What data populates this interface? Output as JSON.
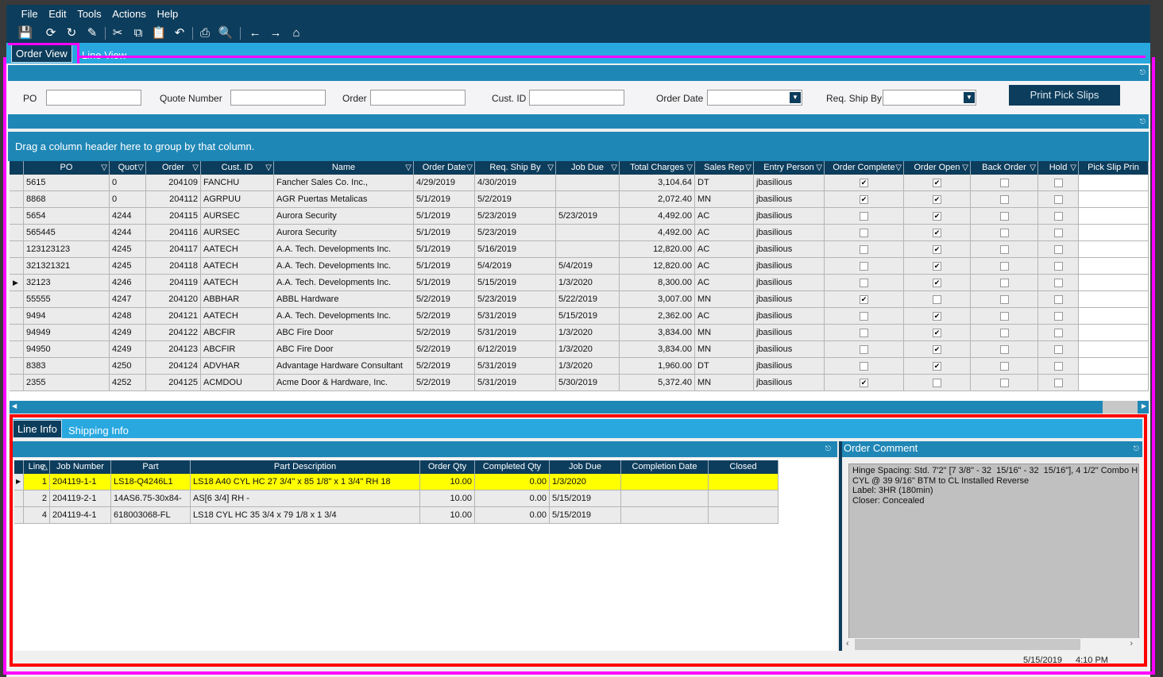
{
  "menu": [
    "File",
    "Edit",
    "Tools",
    "Actions",
    "Help"
  ],
  "toolbar_icons": [
    "save-icon",
    "refresh-icon",
    "sync-icon",
    "clear-icon",
    "cut-icon",
    "copy-icon",
    "paste-icon",
    "undo-icon",
    "print-icon",
    "print-preview-icon",
    "back-icon",
    "forward-icon",
    "home-icon"
  ],
  "tabs": {
    "order_view": "Order View",
    "line_view": "Line View"
  },
  "filters": {
    "po": {
      "label": "PO",
      "value": ""
    },
    "quote": {
      "label": "Quote Number",
      "value": ""
    },
    "order": {
      "label": "Order",
      "value": ""
    },
    "cust": {
      "label": "Cust. ID",
      "value": ""
    },
    "order_date": {
      "label": "Order Date",
      "value": ""
    },
    "req_ship": {
      "label": "Req. Ship By",
      "value": ""
    },
    "print_button": "Print Pick Slips"
  },
  "group_hint": "Drag a column header here to group by that column.",
  "orders": {
    "columns": [
      "PO",
      "Quot",
      "Order",
      "Cust. ID",
      "Name",
      "Order Date",
      "Req. Ship By",
      "Job Due",
      "Total Charges",
      "Sales Rep",
      "Entry Person",
      "Order Complete",
      "Order Open",
      "Back Order",
      "Hold",
      "Pick Slip Prin"
    ],
    "selected_row": 6,
    "rows": [
      [
        "5615",
        "0",
        "204109",
        "FANCHU",
        "Fancher Sales Co. Inc.,",
        "4/29/2019",
        "4/30/2019",
        "",
        "3,104.64",
        "DT",
        "jbasilious",
        true,
        true,
        false,
        false,
        ""
      ],
      [
        "8868",
        "0",
        "204112",
        "AGRPUU",
        "AGR Puertas Metalicas",
        "5/1/2019",
        "5/2/2019",
        "",
        "2,072.40",
        "MN",
        "jbasilious",
        true,
        true,
        false,
        false,
        ""
      ],
      [
        "5654",
        "4244",
        "204115",
        "AURSEC",
        "Aurora Security",
        "5/1/2019",
        "5/23/2019",
        "5/23/2019",
        "4,492.00",
        "AC",
        "jbasilious",
        false,
        true,
        false,
        false,
        ""
      ],
      [
        "565445",
        "4244",
        "204116",
        "AURSEC",
        "Aurora Security",
        "5/1/2019",
        "5/23/2019",
        "",
        "4,492.00",
        "AC",
        "jbasilious",
        false,
        true,
        false,
        false,
        ""
      ],
      [
        "123123123",
        "4245",
        "204117",
        "AATECH",
        "A.A. Tech. Developments Inc.",
        "5/1/2019",
        "5/16/2019",
        "",
        "12,820.00",
        "AC",
        "jbasilious",
        false,
        true,
        false,
        false,
        ""
      ],
      [
        "321321321",
        "4245",
        "204118",
        "AATECH",
        "A.A. Tech. Developments Inc.",
        "5/1/2019",
        "5/4/2019",
        "5/4/2019",
        "12,820.00",
        "AC",
        "jbasilious",
        false,
        true,
        false,
        false,
        ""
      ],
      [
        "32123",
        "4246",
        "204119",
        "AATECH",
        "A.A. Tech. Developments Inc.",
        "5/1/2019",
        "5/15/2019",
        "1/3/2020",
        "8,300.00",
        "AC",
        "jbasilious",
        false,
        true,
        false,
        false,
        ""
      ],
      [
        "55555",
        "4247",
        "204120",
        "ABBHAR",
        "ABBL Hardware",
        "5/2/2019",
        "5/23/2019",
        "5/22/2019",
        "3,007.00",
        "MN",
        "jbasilious",
        true,
        false,
        false,
        false,
        ""
      ],
      [
        "9494",
        "4248",
        "204121",
        "AATECH",
        "A.A. Tech. Developments Inc.",
        "5/2/2019",
        "5/31/2019",
        "5/15/2019",
        "2,362.00",
        "AC",
        "jbasilious",
        false,
        true,
        false,
        false,
        ""
      ],
      [
        "94949",
        "4249",
        "204122",
        "ABCFIR",
        "ABC Fire Door",
        "5/2/2019",
        "5/31/2019",
        "1/3/2020",
        "3,834.00",
        "MN",
        "jbasilious",
        false,
        true,
        false,
        false,
        ""
      ],
      [
        "94950",
        "4249",
        "204123",
        "ABCFIR",
        "ABC Fire Door",
        "5/2/2019",
        "6/12/2019",
        "1/3/2020",
        "3,834.00",
        "MN",
        "jbasilious",
        false,
        true,
        false,
        false,
        ""
      ],
      [
        "8383",
        "4250",
        "204124",
        "ADVHAR",
        "Advantage Hardware Consultant",
        "5/2/2019",
        "5/31/2019",
        "1/3/2020",
        "1,960.00",
        "DT",
        "jbasilious",
        false,
        true,
        false,
        false,
        ""
      ],
      [
        "2355",
        "4252",
        "204125",
        "ACMDOU",
        "Acme Door & Hardware, Inc.",
        "5/2/2019",
        "5/31/2019",
        "5/30/2019",
        "5,372.40",
        "MN",
        "jbasilious",
        true,
        false,
        false,
        false,
        ""
      ]
    ]
  },
  "line_tabs": {
    "line_info": "Line Info",
    "shipping_info": "Shipping Info"
  },
  "lines": {
    "columns": [
      "Line",
      "Job Number",
      "Part",
      "Part Description",
      "Order Qty",
      "Completed Qty",
      "Job Due",
      "Completion Date",
      "Closed"
    ],
    "highlight_color": "#ffff00",
    "rows": [
      [
        "1",
        "204119-1-1",
        "LS18-Q4246L1",
        "LS18  A40  CYL  HC  27 3/4\" x 85 1/8\" x 1 3/4\"  RH  18",
        "10.00",
        "0.00",
        "1/3/2020",
        "",
        ""
      ],
      [
        "2",
        "204119-2-1",
        "14AS6.75-30x84-",
        "AS[6 3/4] RH -",
        "10.00",
        "0.00",
        "5/15/2019",
        "",
        ""
      ],
      [
        "4",
        "204119-4-1",
        "618003068-FL",
        "LS18  CYL  HC  35 3/4 x 79 1/8 x 1 3/4",
        "10.00",
        "0.00",
        "5/15/2019",
        "",
        ""
      ]
    ]
  },
  "comment": {
    "title": "Order Comment",
    "text": "Hinge Spacing: Std. 7'2\" [7 3/8\" - 32  15/16\" - 32  15/16\"], 4 1/2\" Combo H\nCYL @ 39 9/16\" BTM to CL Installed Reverse\nLabel: 3HR (180min)\nCloser: Concealed"
  },
  "status": {
    "date": "5/15/2019",
    "time": "4:10 PM"
  },
  "colors": {
    "navy": "#0d3d5c",
    "blue": "#1f87b6",
    "light_blue": "#29a8e0",
    "annotation_magenta": "#ff00ff",
    "annotation_red": "#ff0000"
  }
}
